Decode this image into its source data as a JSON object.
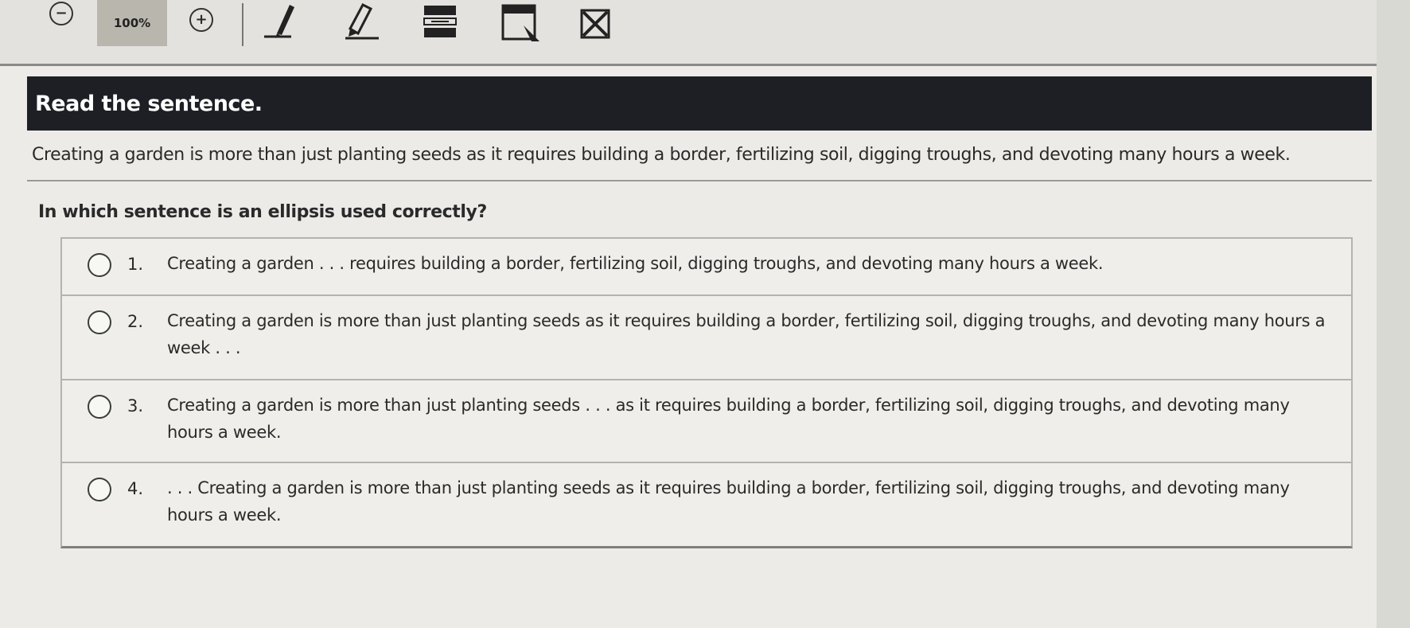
{
  "toolbar": {
    "zoom_out_icon": "minus-circle-icon",
    "zoom_level": "100%",
    "zoom_in_icon": "plus-circle-icon",
    "tools": [
      {
        "name": "pen-icon"
      },
      {
        "name": "highlighter-icon"
      },
      {
        "name": "line-reader-icon"
      },
      {
        "name": "notepad-icon"
      },
      {
        "name": "answer-eliminator-icon"
      }
    ]
  },
  "prompt": "Read the sentence.",
  "passage": "Creating a garden is more than just planting seeds as it requires building a border, fertilizing soil, digging troughs, and devoting many hours a week.",
  "question": "In which sentence is an ellipsis used correctly?",
  "choices": [
    {
      "number": "1.",
      "text": "Creating a garden . . . requires building a border, fertilizing soil, digging troughs, and devoting many hours a week."
    },
    {
      "number": "2.",
      "text": "Creating a garden is more than just planting seeds as it requires building a border, fertilizing soil, digging troughs, and devoting many hours a week . . ."
    },
    {
      "number": "3.",
      "text": "Creating a garden is more than just planting seeds . . . as it requires building a border, fertilizing soil, digging troughs, and devoting many hours a week."
    },
    {
      "number": "4.",
      "text": ". . . Creating a garden is more than just planting seeds as it requires building a border, fertilizing soil, digging troughs, and devoting many hours a week."
    }
  ]
}
